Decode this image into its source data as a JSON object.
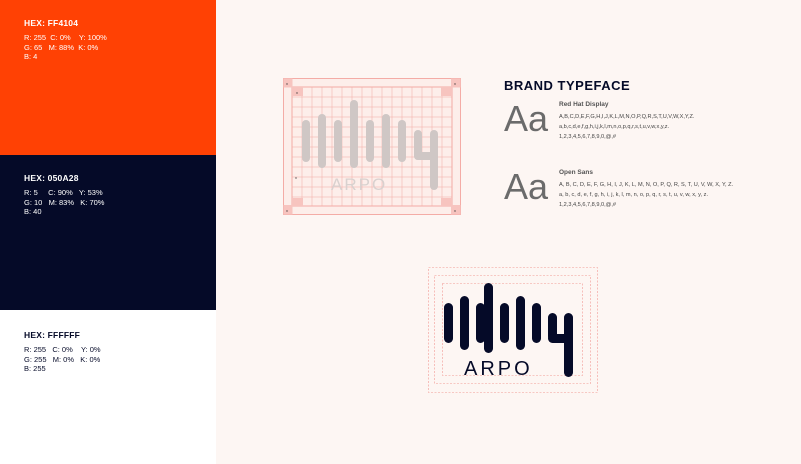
{
  "swatches": [
    {
      "hex": "HEX: FF4104",
      "line1": "R: 255  C: 0%    Y: 100%",
      "line2": "G: 65   M: 88%  K: 0%",
      "line3": "B: 4",
      "color": "#ff4104"
    },
    {
      "hex": "HEX: 050A28",
      "line1": "R: 5     C: 90%   Y: 53%",
      "line2": "G: 10   M: 83%   K: 70%",
      "line3": "B: 40",
      "color": "#050a28"
    },
    {
      "hex": "HEX: FFFFFF",
      "line1": "R: 255   C: 0%    Y: 0%",
      "line2": "G: 255   M: 0%   K: 0%",
      "line3": "B: 255",
      "color": "#ffffff"
    }
  ],
  "typeface": {
    "title": "BRAND TYPEFACE",
    "fonts": [
      {
        "sample": "Aa",
        "name": "Red Hat Display",
        "upper": "A,B,C,D,E,F,G,H,I,J,K,L,M,N,O,P,Q,R,S,T,U,V,W,X,Y,Z.",
        "lower": "a,b,c,d,e,f,g,h,i,j,k,l,m,n,o,p,q,r,s,t,u,v,w,x,y,z.",
        "nums": "1,2,3,4,5,6,7,8,9,0,@,#"
      },
      {
        "sample": "Aa",
        "name": "Open Sans",
        "upper": "A, B, C, D, E, F, G, H, I, J, K, L, M, N, O, P, Q, R, S, T, U, V, W, X, Y, Z.",
        "lower": "a, b, c, d, e, f, g, h, i, j, k, l, m, n, o, p, q, r, s, t, u, v, w, x, y, z.",
        "nums": "1,2,3,4,5,6,7,8,9,0,@,#"
      }
    ]
  },
  "grid_marks": {
    "corner": "x"
  },
  "logo": {
    "wordmark": "ARPO",
    "wordmark_grid": "ARPO"
  },
  "colors": {
    "accent": "#ff4104",
    "navy": "#050a28",
    "white": "#ffffff",
    "grid": "#f29a94",
    "background": "#fdf6f3"
  }
}
